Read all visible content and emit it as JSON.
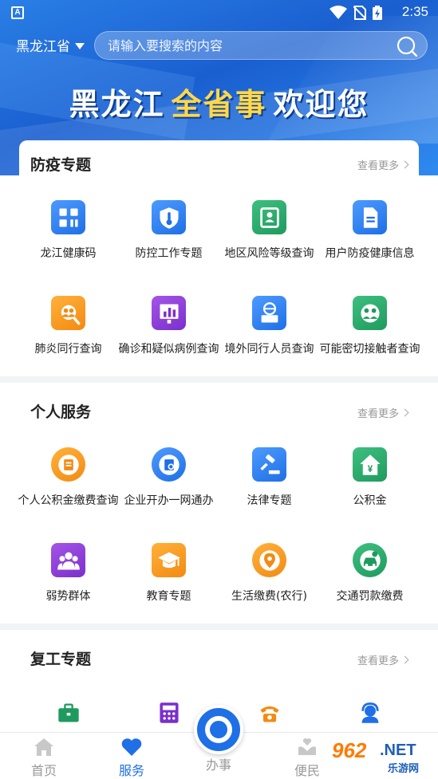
{
  "status_bar": {
    "time": "2:35",
    "app_badge": "A"
  },
  "header": {
    "region": "黑龙江省",
    "search_placeholder": "请输入要搜索的内容",
    "welcome_left": "黑龙江",
    "welcome_mid": "全省事",
    "welcome_right": "欢迎您"
  },
  "sections": [
    {
      "title": "防疫专题",
      "more": "查看更多",
      "items": [
        {
          "label": "龙江健康码",
          "icon": "qr-code-icon",
          "color": "blue"
        },
        {
          "label": "防控工作专题",
          "icon": "shield-thermometer-icon",
          "color": "blue"
        },
        {
          "label": "地区风险等级查询",
          "icon": "risk-map-icon",
          "color": "green"
        },
        {
          "label": "用户防疫健康信息",
          "icon": "document-icon",
          "color": "blue"
        },
        {
          "label": "肺炎同行查询",
          "icon": "people-search-icon",
          "color": "orange"
        },
        {
          "label": "确诊和疑似病例查询",
          "icon": "bar-chart-icon",
          "color": "purple"
        },
        {
          "label": "境外同行人员查询",
          "icon": "globe-computer-icon",
          "color": "blue"
        },
        {
          "label": "可能密切接触者查询",
          "icon": "contact-icon",
          "color": "green"
        }
      ]
    },
    {
      "title": "个人服务",
      "more": "查看更多",
      "items": [
        {
          "label": "个人公积金缴费查询",
          "icon": "fund-doc-icon",
          "color": "orange"
        },
        {
          "label": "企业开办一网通办",
          "icon": "business-doc-icon",
          "color": "blue"
        },
        {
          "label": "法律专题",
          "icon": "gavel-icon",
          "color": "blue"
        },
        {
          "label": "公积金",
          "icon": "house-yuan-icon",
          "color": "green"
        },
        {
          "label": "弱势群体",
          "icon": "group-icon",
          "color": "purple"
        },
        {
          "label": "教育专题",
          "icon": "graduation-cap-icon",
          "color": "orange"
        },
        {
          "label": "生活缴费(农行)",
          "icon": "location-pay-icon",
          "color": "orange"
        },
        {
          "label": "交通罚款缴费",
          "icon": "car-fine-icon",
          "color": "green"
        }
      ]
    },
    {
      "title": "复工专题",
      "more": "查看更多",
      "items": [
        {
          "label": "",
          "icon": "briefcase-icon",
          "color": "green"
        },
        {
          "label": "",
          "icon": "calculator-icon",
          "color": "purple"
        },
        {
          "label": "",
          "icon": "telephone-icon",
          "color": "orange"
        },
        {
          "label": "",
          "icon": "customer-service-icon",
          "color": "blue"
        }
      ]
    }
  ],
  "tabbar": {
    "home": "首页",
    "service": "服务",
    "center": "办事",
    "convenience": "便民"
  },
  "watermark": {
    "num": "962",
    "net": ".NET",
    "cn": "乐游网"
  }
}
